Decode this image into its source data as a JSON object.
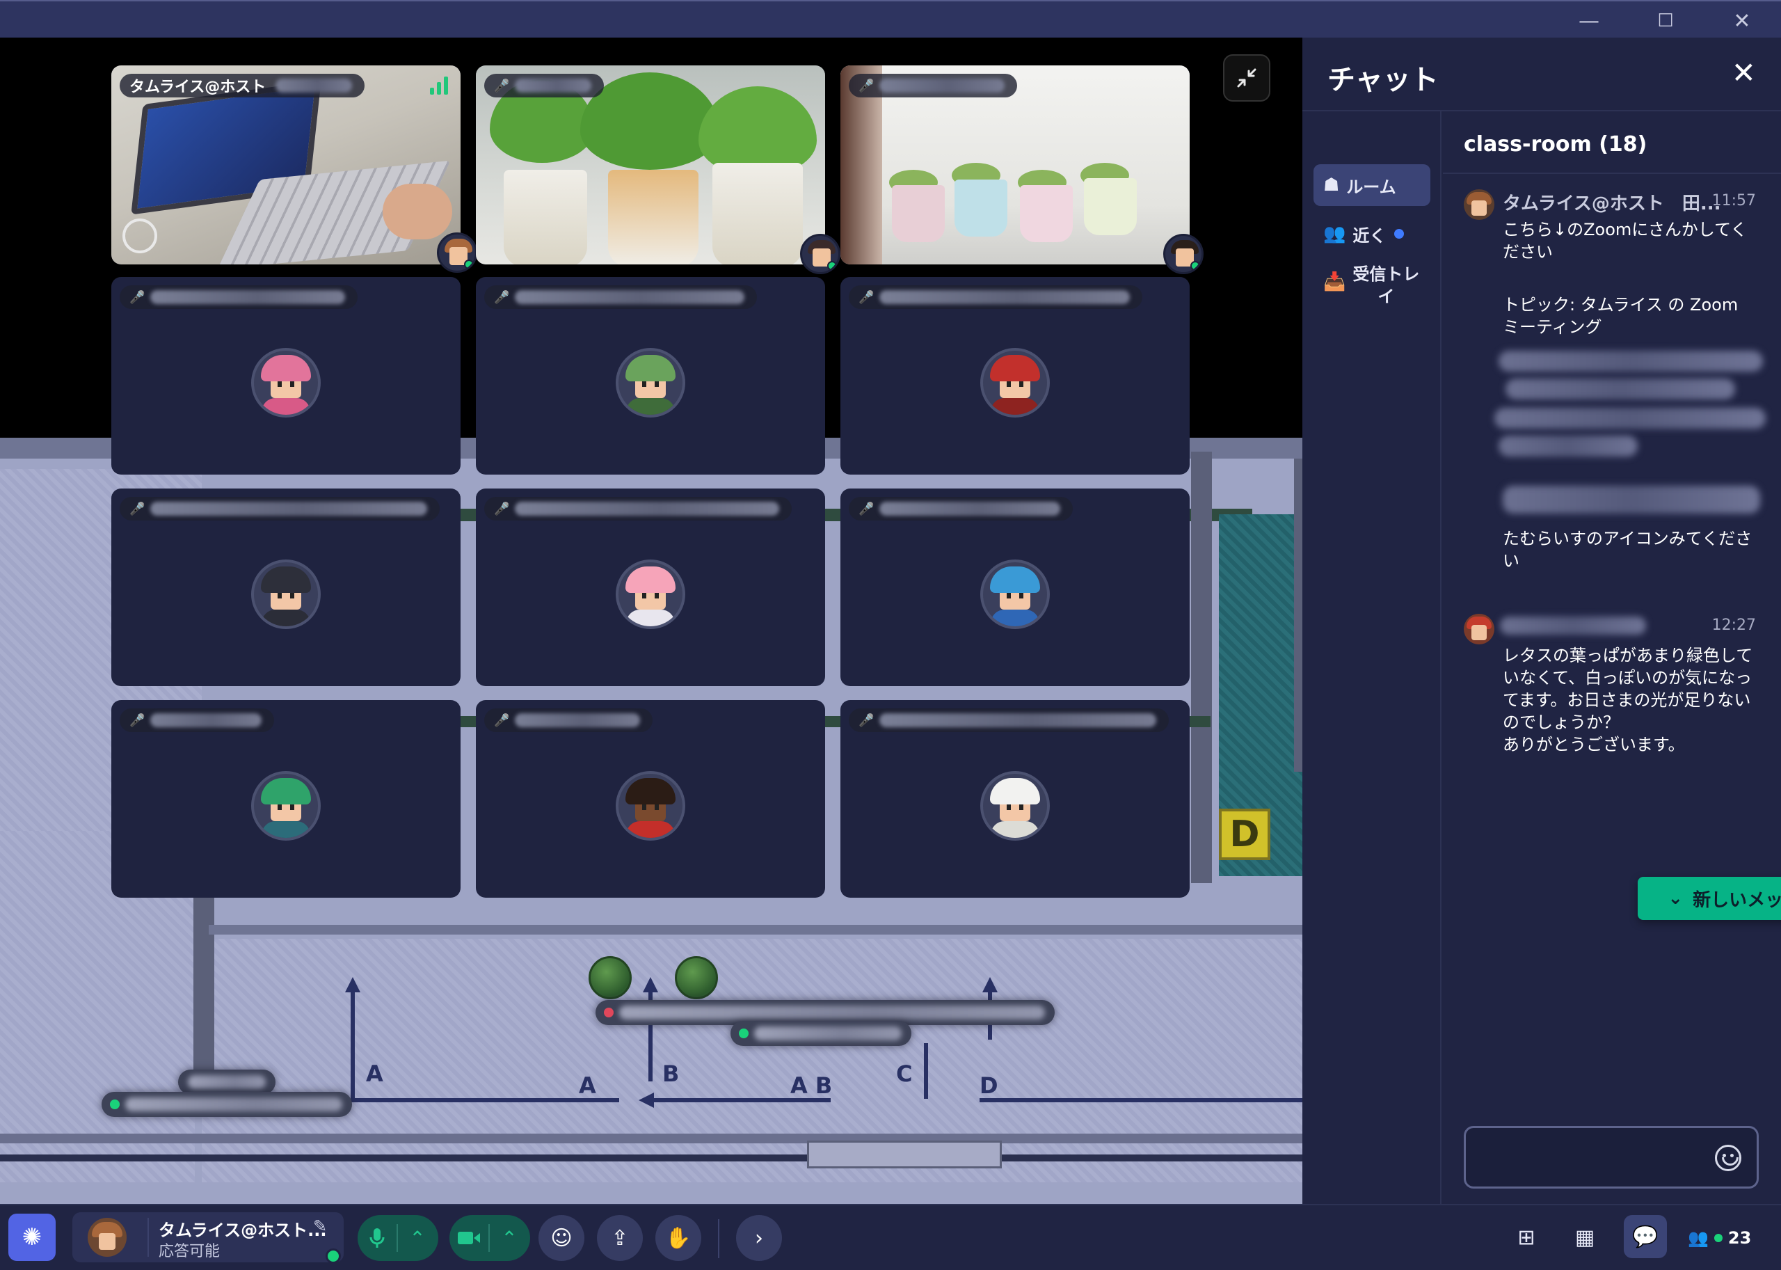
{
  "window": {
    "minimize": "—",
    "maximize": "☐",
    "close": "✕"
  },
  "stage": {
    "collapse_icon": "collapse-arrows",
    "tiles": [
      {
        "label": "タムライス@ホスト",
        "type": "video-laptop",
        "muted": false
      },
      {
        "label": "",
        "type": "video-plants",
        "muted": true
      },
      {
        "label": "",
        "type": "video-cups",
        "muted": true
      },
      {
        "label": "",
        "type": "avatar",
        "muted": true,
        "hair": "#e2749b",
        "body": "#d85a87"
      },
      {
        "label": "",
        "type": "avatar",
        "muted": true,
        "hair": "#6aa35c",
        "body": "#3f6c3a"
      },
      {
        "label": "",
        "type": "avatar",
        "muted": true,
        "hair": "#c2302c",
        "body": "#8e2320"
      },
      {
        "label": "",
        "type": "avatar",
        "muted": true,
        "hair": "#2d2f3a",
        "body": "#2b2d38"
      },
      {
        "label": "",
        "type": "avatar",
        "muted": true,
        "hair": "#f6a4b9",
        "body": "#e8e6ee"
      },
      {
        "label": "",
        "type": "avatar",
        "muted": true,
        "hair": "#3a9ad6",
        "body": "#2f67b6"
      },
      {
        "label": "",
        "type": "avatar",
        "muted": true,
        "hair": "#2fa36a",
        "body": "#2c6c7a"
      },
      {
        "label": "",
        "type": "avatar",
        "muted": true,
        "hair": "#2b1c15",
        "body": "#c42f2a"
      },
      {
        "label": "",
        "type": "avatar",
        "muted": true,
        "hair": "#f2f2f0",
        "body": "#dcdcd6"
      }
    ],
    "map_letters": [
      "A",
      "A",
      "B",
      "A B",
      "C",
      "D"
    ],
    "sign": "D"
  },
  "chat": {
    "title": "チャット",
    "close_icon": "close-icon",
    "nav": [
      {
        "label": "ルーム",
        "icon": "room-icon"
      },
      {
        "label": "近く",
        "icon": "people-icon"
      },
      {
        "label": "受信トレイ",
        "icon": "inbox-icon"
      }
    ],
    "room": "class-room (18)",
    "messages": [
      {
        "author": "タムライス@ホスト　田...",
        "time": "11:57",
        "text_1": "こちら↓のZoomにさんかしてください",
        "text_2": "トピック: タムライス の Zoom ミーティング",
        "text_3": "たむらいすのアイコンみてください"
      },
      {
        "author": "",
        "time": "12:27",
        "text": "レタスの葉っぱがあまり緑色していなくて、白っぽいのが気になってます。お日さまの光が足りないのでしょうか？\nありがとうございます。"
      }
    ],
    "new_message_button": "新しいメッセージ",
    "composer_placeholder": ""
  },
  "bottombar": {
    "me": {
      "name": "タムライス@ホスト...",
      "status": "応答可能"
    },
    "people_count": "23"
  },
  "colors": {
    "accent_green": "#06b386",
    "panel": "#202443",
    "nav_active": "#3b4476"
  }
}
